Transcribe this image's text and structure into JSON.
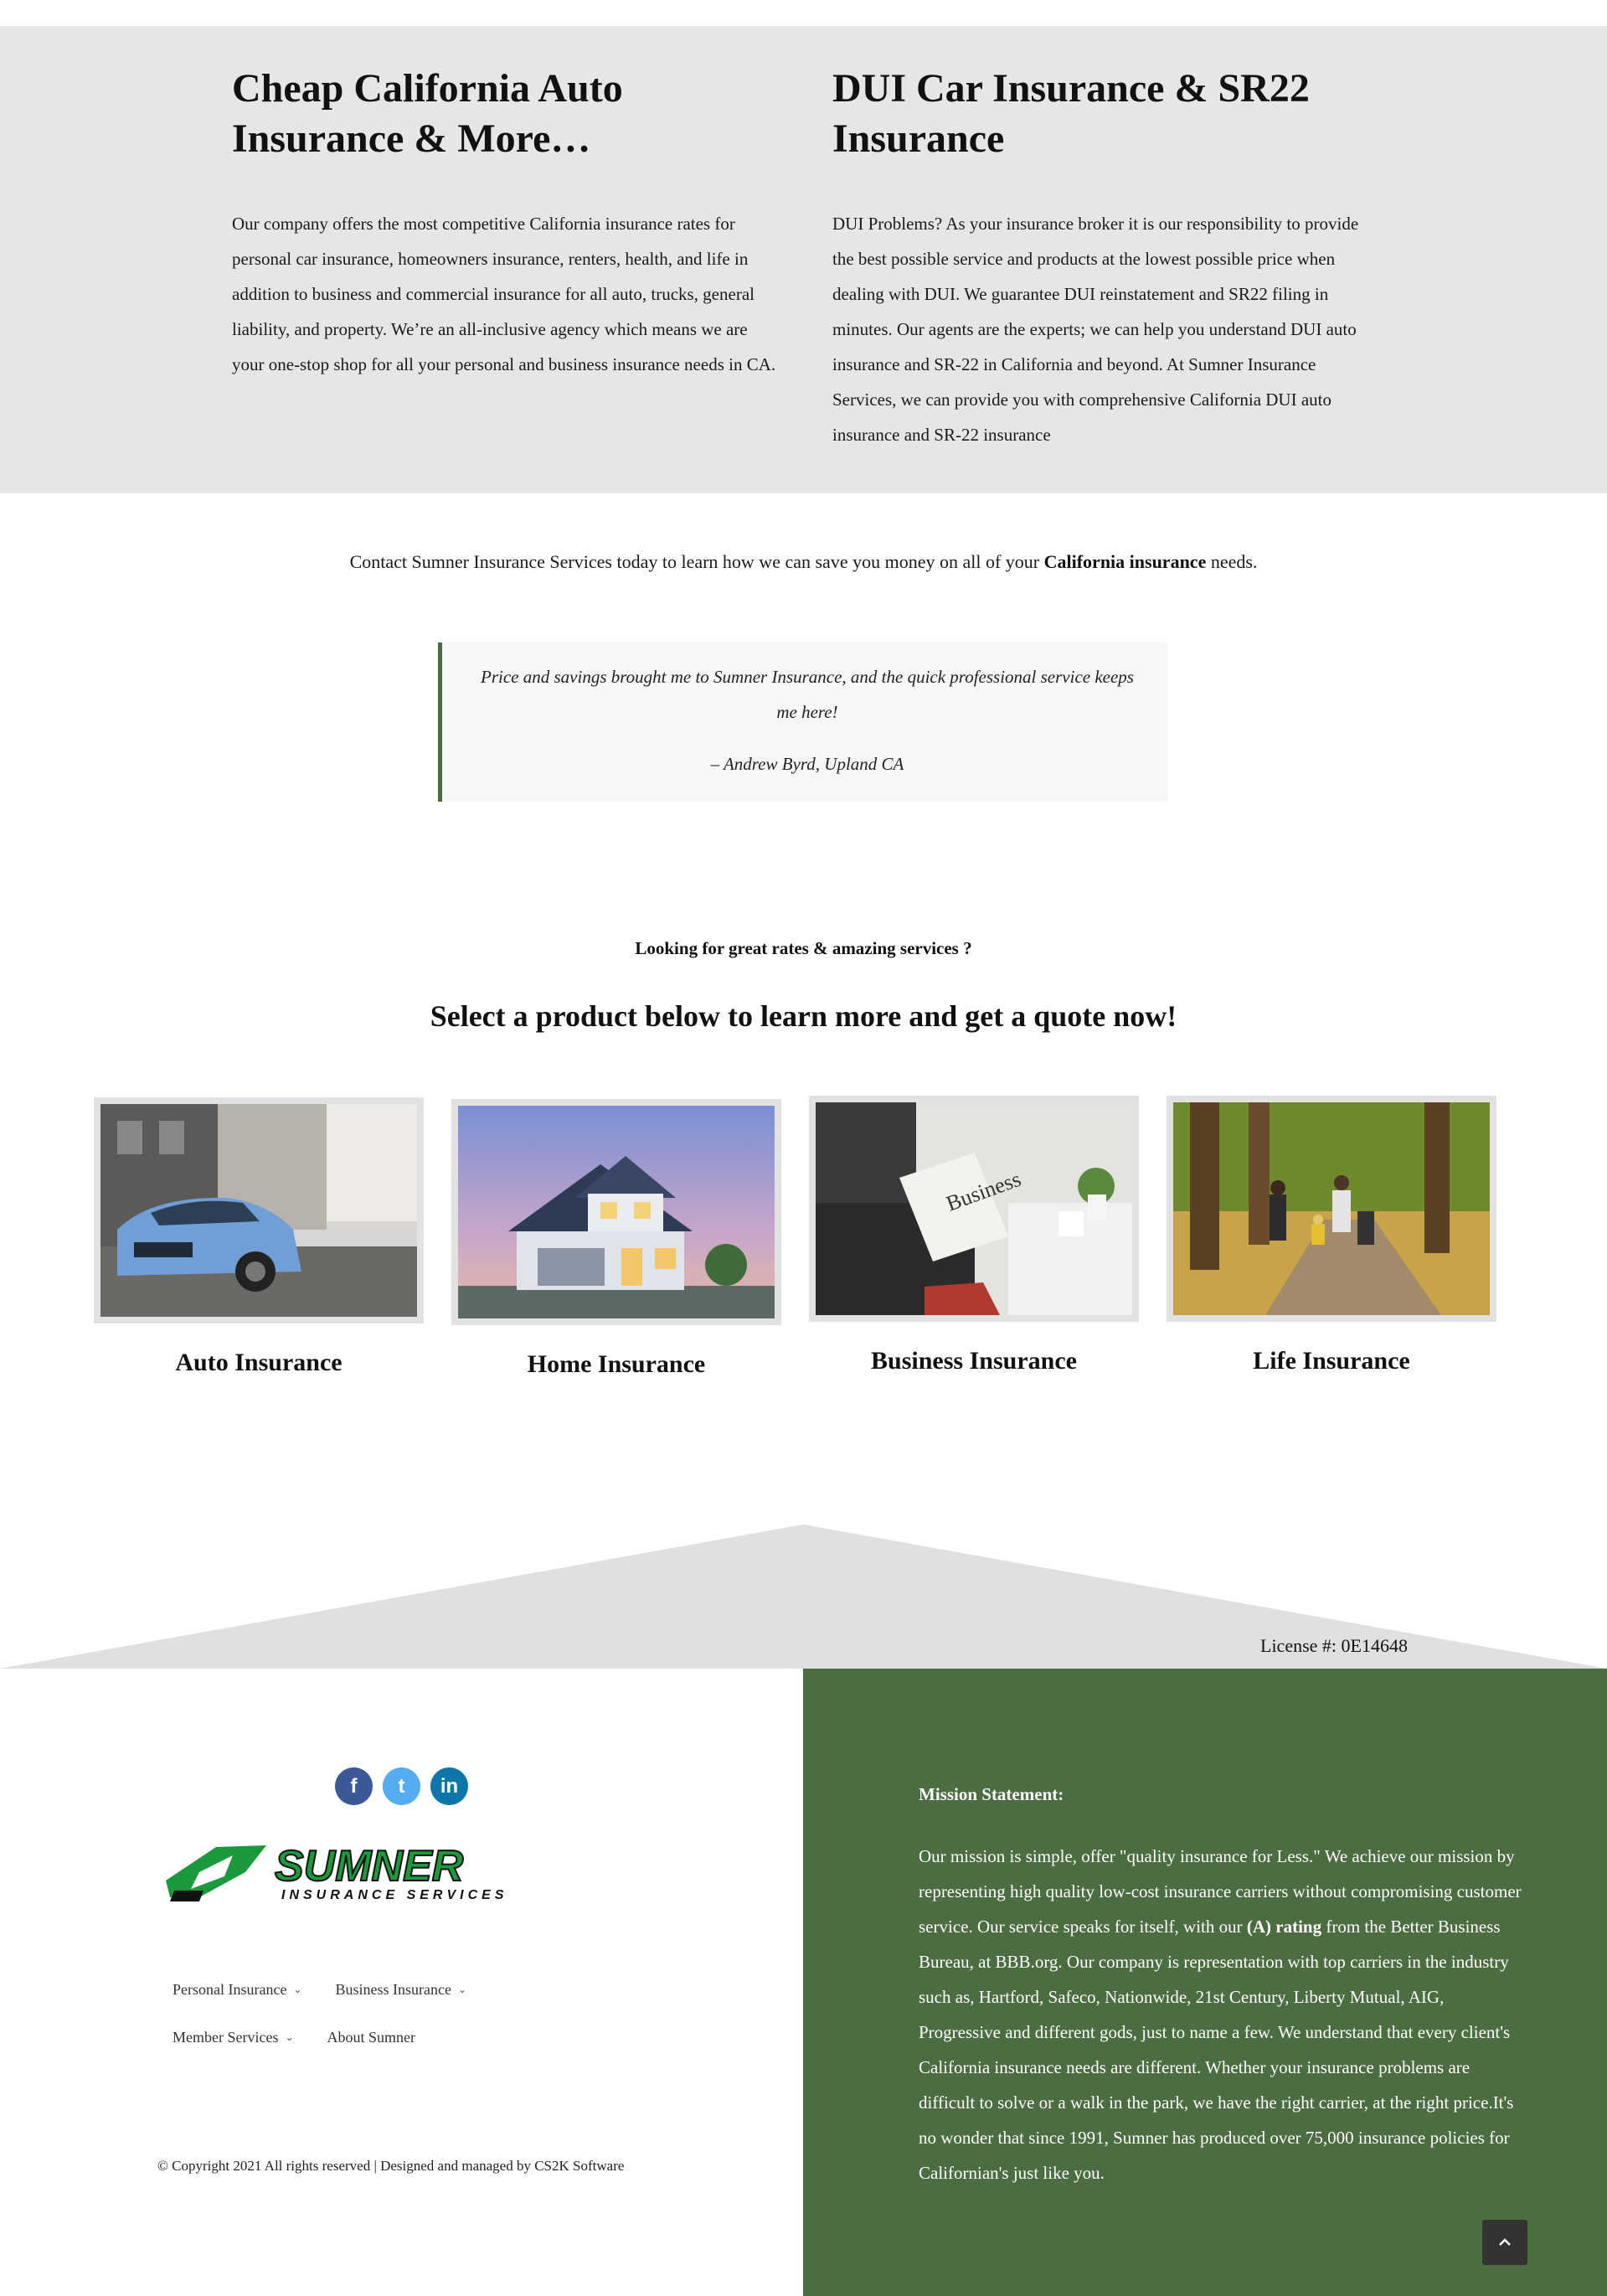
{
  "intro": {
    "left": {
      "title": "Cheap California Auto Insurance & More…",
      "body": "Our company offers the most competitive California insurance rates for personal car insurance, homeowners insurance, renters, health, and life in addition to business and commercial insurance for all auto, trucks, general liability, and property. We’re an all-inclusive agency which means we are your one-stop shop for all your personal and business insurance needs in CA."
    },
    "right": {
      "title": "DUI Car Insurance & SR22 Insurance",
      "body": "DUI Problems? As your insurance broker it is our responsibility to provide the best possible service and products at the lowest possible price when dealing with DUI. We guarantee DUI reinstatement and SR22 filing in minutes. Our agents are the experts; we can help you understand DUI auto insurance and SR-22 in California and beyond. At Sumner Insurance Services, we can provide you with comprehensive California DUI auto insurance and SR-22 insurance"
    }
  },
  "contact": {
    "before": "Contact Sumner Insurance Services today to learn how we can save you money on all of your ",
    "bold": "California insurance",
    "after": " needs."
  },
  "testimonial": {
    "text": "Price and savings brought me to Sumner Insurance, and the quick professional service keeps me here!",
    "author": "– Andrew Byrd, Upland CA"
  },
  "products": {
    "eyebrow": "Looking for great rates & amazing services ?",
    "heading": "Select a product below to learn more and get a quote now!",
    "items": [
      {
        "label": "Auto Insurance",
        "image": "blue-car-photo"
      },
      {
        "label": "Home Insurance",
        "image": "house-photo"
      },
      {
        "label": "Business Insurance",
        "image": "newspaper-photo"
      },
      {
        "label": "Life Insurance",
        "image": "family-park-photo"
      }
    ]
  },
  "license": "License #: 0E14648",
  "footer": {
    "social": [
      {
        "icon": "facebook-icon",
        "glyph": "f"
      },
      {
        "icon": "twitter-icon",
        "glyph": "t"
      },
      {
        "icon": "linkedin-icon",
        "glyph": "in"
      }
    ],
    "logo": {
      "name": "SUMNER",
      "tagline": "INSURANCE SERVICES"
    },
    "nav": [
      {
        "label": "Personal Insurance",
        "dropdown": true
      },
      {
        "label": "Business Insurance",
        "dropdown": true
      },
      {
        "label": "Member Services",
        "dropdown": true
      },
      {
        "label": "About Sumner",
        "dropdown": false
      }
    ],
    "copyright": "© Copyright 2021 All rights reserved | Designed and managed by CS2K Software",
    "mission": {
      "title": "Mission Statement:",
      "p1": "Our mission is simple, offer \"quality insurance for Less.\" We achieve our mission by representing high quality low-cost insurance carriers without compromising customer service. Our service speaks for itself, with our ",
      "bold": "(A) rating",
      "p2": " from the Better Business Bureau, at BBB.org. Our company is representation with top carriers in the industry such as, Hartford, Safeco, Nationwide, 21st Century, Liberty Mutual, AIG, Progressive and different gods, just to name a few. We understand that every client's California insurance needs are different. Whether your insurance problems are difficult to solve or a walk in the park, we have the right carrier, at the right price.It's no wonder that since 1991, Sumner has produced over 75,000 insurance policies for Californian's just like you."
    },
    "to_top_icon": "chevron-up-icon"
  },
  "colors": {
    "band": "#e6e6e6",
    "green": "#4b6d41",
    "logo_green": "#1a9a3c"
  }
}
